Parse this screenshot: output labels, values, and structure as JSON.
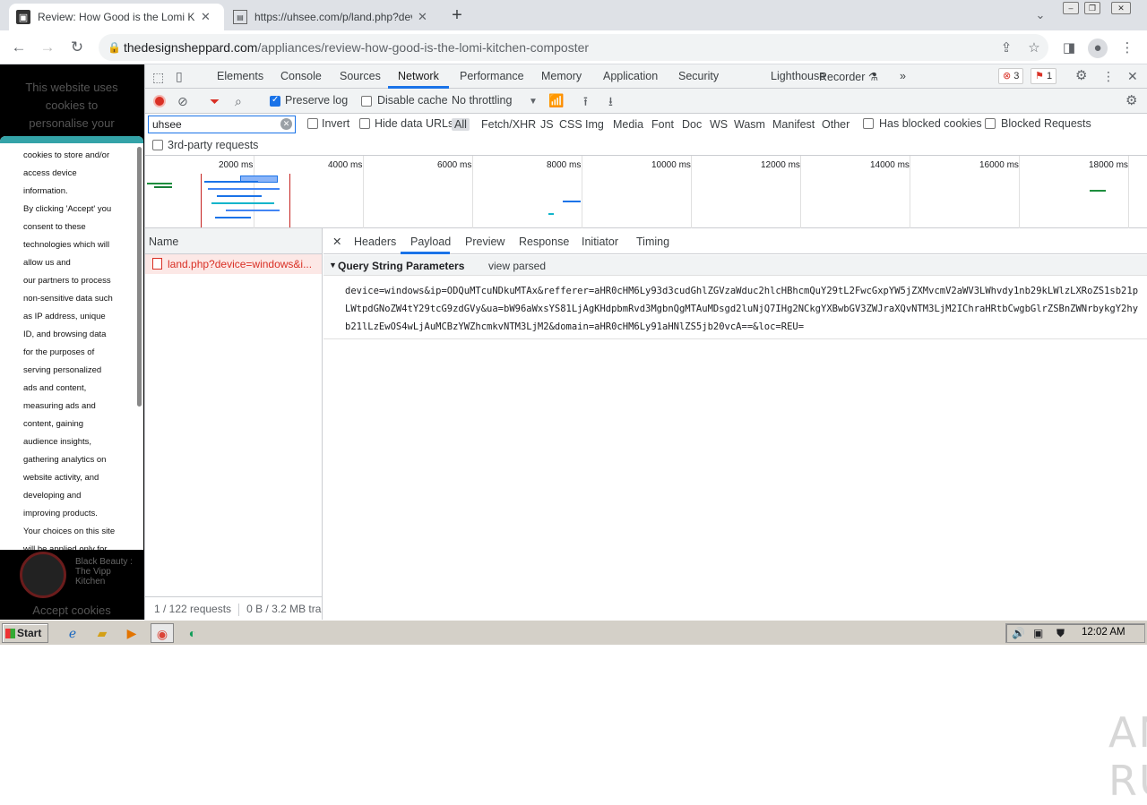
{
  "browser": {
    "tabs": [
      {
        "title": "Review: How Good is the Lomi Kitche",
        "active": true
      },
      {
        "title": "https://uhsee.com/p/land.php?devic",
        "active": false
      }
    ],
    "url_host": "thedesignsheppard.com",
    "url_path": "/appliances/review-how-good-is-the-lomi-kitchen-composter"
  },
  "page": {
    "dim_lines": [
      "This website uses",
      "cookies to",
      "personalise your"
    ],
    "cookie_lines": [
      "cookies to store and/or",
      "access device",
      "information.",
      "By clicking 'Accept' you",
      "consent to these",
      "technologies which will",
      "allow us and",
      "our partners to process",
      "non-sensitive data such",
      "as IP address, unique",
      "ID, and browsing data",
      "for the purposes of",
      "serving personalized",
      "ads and content,",
      "measuring ads and",
      "content, gaining",
      "audience insights,",
      "gathering analytics on",
      "website activity, and",
      "developing and",
      "improving products.",
      "Your choices on this site",
      "will be applied only for"
    ],
    "promo_lines": [
      "Black Beauty :",
      "The Vipp",
      "Kitchen"
    ],
    "accept_text": "Accept cookies"
  },
  "devtools": {
    "tabs": [
      "Elements",
      "Console",
      "Sources",
      "Network",
      "Performance",
      "Memory",
      "Application",
      "Security",
      "Lighthouse",
      "Recorder"
    ],
    "active_tab": "Network",
    "errors": "3",
    "issues": "1",
    "toolbar": {
      "preserve_log": "Preserve log",
      "disable_cache": "Disable cache",
      "throttling": "No throttling"
    },
    "filter": {
      "value": "uhsee",
      "invert": "Invert",
      "hide_data_urls": "Hide data URLs",
      "types": [
        "All",
        "Fetch/XHR",
        "JS",
        "CSS",
        "Img",
        "Media",
        "Font",
        "Doc",
        "WS",
        "Wasm",
        "Manifest",
        "Other"
      ],
      "has_blocked_cookies": "Has blocked cookies",
      "blocked_requests": "Blocked Requests",
      "third_party": "3rd-party requests"
    },
    "timeline_ticks": [
      "2000 ms",
      "4000 ms",
      "6000 ms",
      "8000 ms",
      "10000 ms",
      "12000 ms",
      "14000 ms",
      "16000 ms",
      "18000 ms"
    ],
    "requests": {
      "header": "Name",
      "rows": [
        "land.php?device=windows&i..."
      ],
      "footer_count": "1 / 122 requests",
      "footer_size": "0 B / 3.2 MB tra"
    },
    "detail_tabs": [
      "Headers",
      "Payload",
      "Preview",
      "Response",
      "Initiator",
      "Timing"
    ],
    "active_detail_tab": "Payload",
    "payload": {
      "section_title": "Query String Parameters",
      "view_parsed": "view parsed",
      "query_string": "device=windows&ip=ODQuMTcuNDkuMTAx&refferer=aHR0cHM6Ly93d3cudGhlZGVzaWduc2hlcHBhcmQuY29tL2FwcGxpYW5jZXMvcmV2aWV3LWhvdy1nb29kLWlzLXRoZS1sb21pLWtpdGNoZW4tY29tcG9zdGVy&ua=bW96aWxsYS81LjAgKHdpbmRvd3MgbnQgMTAuMDsgd2luNjQ7IHg2NCkgYXBwbGV3ZWJraXQvNTM3LjM2IChraHRtbCwgbGlrZSBnZWNrbykgY2hyb21lLzEwOS4wLjAuMCBzYWZhcmkvNTM3LjM2&domain=aHR0cHM6Ly91aHNlZS5jb20vcA==&loc=REU="
    }
  },
  "watermark": "ANY RUN",
  "taskbar": {
    "start": "Start",
    "clock": "12:02 AM"
  }
}
